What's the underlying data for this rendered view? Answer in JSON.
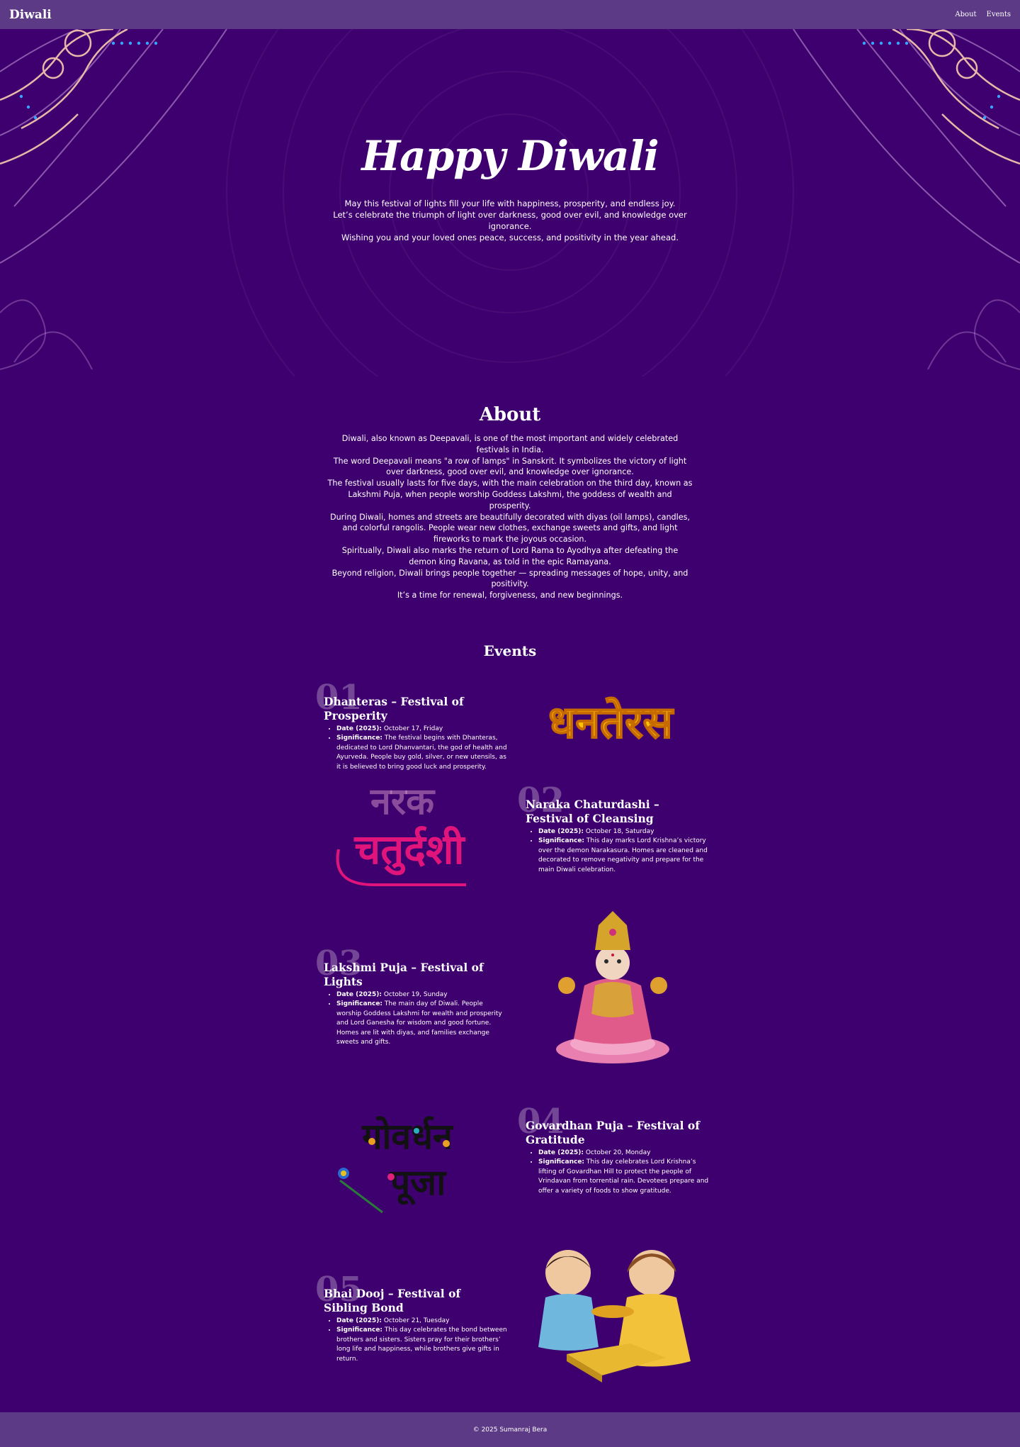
{
  "nav": {
    "brand": "Diwali",
    "links": [
      "About",
      "Events"
    ]
  },
  "hero": {
    "title": "Happy Diwali",
    "lines": [
      "May this festival of lights fill your life with happiness, prosperity, and endless joy.",
      "Let’s celebrate the triumph of light over darkness, good over evil, and knowledge over ignorance.",
      "Wishing you and your loved ones peace, success, and positivity in the year ahead."
    ]
  },
  "about": {
    "title": "About",
    "paragraphs": [
      "Diwali, also known as Deepavali, is one of the most important and widely celebrated festivals in India.",
      "The word Deepavali means \"a row of lamps\" in Sanskrit. It symbolizes the victory of light over darkness, good over evil, and knowledge over ignorance.",
      "The festival usually lasts for five days, with the main celebration on the third day, known as Lakshmi Puja, when people worship Goddess Lakshmi, the goddess of wealth and prosperity.",
      "During Diwali, homes and streets are beautifully decorated with diyas (oil lamps), candles, and colorful rangolis. People wear new clothes, exchange sweets and gifts, and light fireworks to mark the joyous occasion.",
      "Spiritually, Diwali also marks the return of Lord Rama to Ayodhya after defeating the demon king Ravana, as told in the epic Ramayana.",
      "Beyond religion, Diwali brings people together — spreading messages of hope, unity, and positivity.",
      "It’s a time for renewal, forgiveness, and new beginnings."
    ]
  },
  "events": {
    "title": "Events",
    "date_label": "Date (2025):",
    "significance_label": "Significance:",
    "items": [
      {
        "num": "01",
        "title": "Dhanteras – Festival of Prosperity",
        "date": "October 17, Friday",
        "significance": "The festival begins with Dhanteras, dedicated to Lord Dhanvantari, the god of health and Ayurveda. People buy gold, silver, or new utensils, as it is believed to bring good luck and prosperity.",
        "image_text": "धनतेरस"
      },
      {
        "num": "02",
        "title": "Naraka Chaturdashi – Festival of Cleansing",
        "date": "October 18, Saturday",
        "significance": "This day marks Lord Krishna’s victory over the demon Narakasura. Homes are cleaned and decorated to remove negativity and prepare for the main Diwali celebration.",
        "image_text_top": "नरक",
        "image_text_bottom": "चतुर्दशी"
      },
      {
        "num": "03",
        "title": "Lakshmi Puja – Festival of Lights",
        "date": "October 19, Sunday",
        "significance": "The main day of Diwali. People worship Goddess Lakshmi for wealth and prosperity and Lord Ganesha for wisdom and good fortune. Homes are lit with diyas, and families exchange sweets and gifts."
      },
      {
        "num": "04",
        "title": "Govardhan Puja – Festival of Gratitude",
        "date": "October 20, Monday",
        "significance": "This day celebrates Lord Krishna’s lifting of Govardhan Hill to protect the people of Vrindavan from torrential rain. Devotees prepare and offer a variety of foods to show gratitude.",
        "image_text_top": "गोवर्धन",
        "image_text_bottom": "पूजा"
      },
      {
        "num": "05",
        "title": "Bhai Dooj – Festival of Sibling Bond",
        "date": "October 21, Tuesday",
        "significance": "This day celebrates the bond between brothers and sisters. Sisters pray for their brothers’ long life and happiness, while brothers give gifts in return."
      }
    ]
  },
  "footer": {
    "text": "© 2025 Sumanraj Bera"
  },
  "colors": {
    "background": "#3e006e",
    "bar": "#5c3a86"
  }
}
